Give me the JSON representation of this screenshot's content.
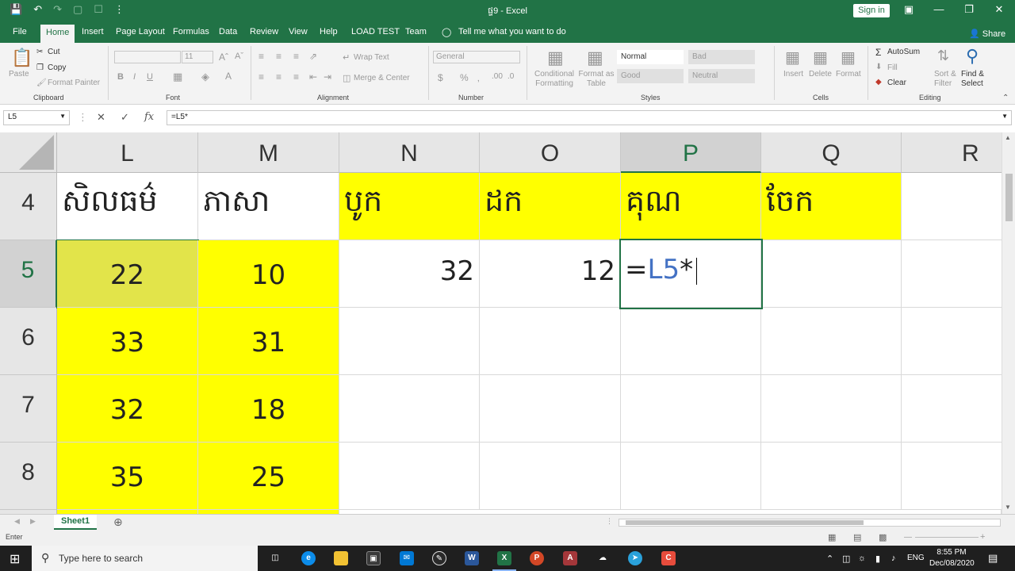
{
  "window": {
    "title": "ផ្ទ9 - Excel",
    "signin": "Sign in"
  },
  "menu": {
    "tabs": [
      "File",
      "Home",
      "Insert",
      "Page Layout",
      "Formulas",
      "Data",
      "Review",
      "View",
      "Help",
      "LOAD TEST",
      "Team"
    ],
    "tell_me": "Tell me what you want to do",
    "share": "Share"
  },
  "ribbon": {
    "clipboard": {
      "paste": "Paste",
      "cut": "Cut",
      "copy": "Copy",
      "format_painter": "Format Painter",
      "label": "Clipboard"
    },
    "font": {
      "size": "11",
      "label": "Font"
    },
    "alignment": {
      "wrap": "Wrap Text",
      "merge": "Merge & Center",
      "label": "Alignment"
    },
    "number": {
      "format": "General",
      "label": "Number"
    },
    "styles": {
      "conditional": "Conditional Formatting",
      "format_table": "Format as Table",
      "normal": "Normal",
      "bad": "Bad",
      "good": "Good",
      "neutral": "Neutral",
      "label": "Styles"
    },
    "cells": {
      "insert": "Insert",
      "delete": "Delete",
      "format": "Format",
      "label": "Cells"
    },
    "editing": {
      "autosum": "AutoSum",
      "fill": "Fill",
      "clear": "Clear",
      "sort": "Sort & Filter",
      "find": "Find & Select",
      "label": "Editing"
    }
  },
  "formula_bar": {
    "name_box": "L5",
    "formula": "=L5*"
  },
  "columns": [
    "L",
    "M",
    "N",
    "O",
    "P",
    "Q",
    "R"
  ],
  "rows": [
    "4",
    "5",
    "6",
    "7",
    "8"
  ],
  "cells": {
    "r4": [
      "សិលធម៌",
      "ភាសា",
      "បូក",
      "ដក",
      "គុណ",
      "ចែក",
      ""
    ],
    "r5": [
      "22",
      "10",
      "32",
      "12",
      "",
      "",
      ""
    ],
    "r6": [
      "33",
      "31",
      "",
      "",
      "",
      "",
      ""
    ],
    "r7": [
      "32",
      "18",
      "",
      "",
      "",
      "",
      ""
    ],
    "r8": [
      "35",
      "25",
      "",
      "",
      "",
      "",
      ""
    ]
  },
  "active_cell": {
    "eq": "=",
    "ref": "L5",
    "op": "*"
  },
  "sheet": {
    "tab": "Sheet1"
  },
  "status": {
    "mode": "Enter"
  },
  "taskbar": {
    "search_placeholder": "Type here to search",
    "time": "8:55 PM",
    "date": "Dec/08/2020",
    "lang": "ENG"
  },
  "colors": {
    "excel_green": "#217346",
    "yellow": "#ffff00",
    "ref_blue": "#4472c4"
  }
}
